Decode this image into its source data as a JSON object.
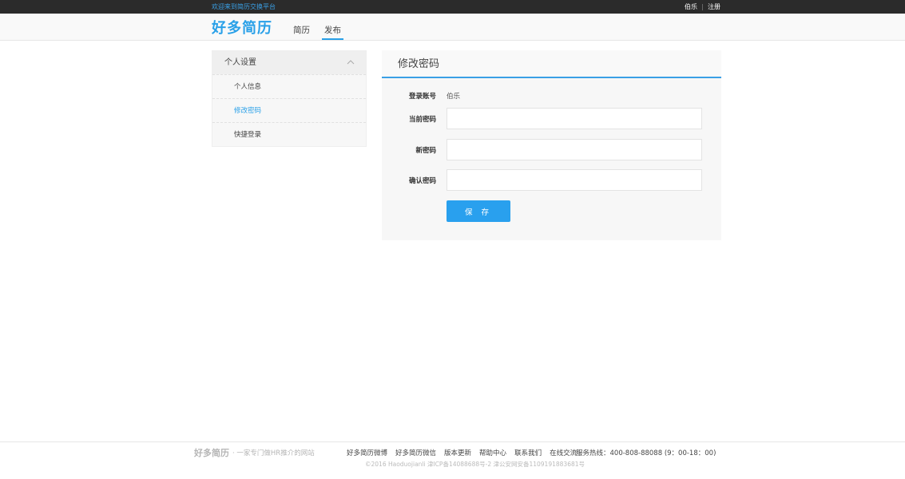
{
  "topbar": {
    "welcome": "欢迎来到简历交换平台",
    "user": "伯乐",
    "register": "注册"
  },
  "header": {
    "logo": "好多简历",
    "nav": [
      {
        "label": "简历",
        "active": false
      },
      {
        "label": "发布",
        "active": true
      }
    ]
  },
  "sidebar": {
    "title": "个人设置",
    "items": [
      {
        "label": "个人信息",
        "active": false
      },
      {
        "label": "修改密码",
        "active": true
      },
      {
        "label": "快捷登录",
        "active": false
      }
    ]
  },
  "panel": {
    "title": "修改密码",
    "account_label": "登录账号",
    "account_value": "伯乐",
    "current_password_label": "当前密码",
    "new_password_label": "新密码",
    "confirm_password_label": "确认密码",
    "current_password_value": "",
    "new_password_value": "",
    "confirm_password_value": "",
    "save_label": "保 存"
  },
  "footer": {
    "logo": "好多简历",
    "slogan": "· 一家专门做HR推介的网站",
    "links": [
      "好多简历微博",
      "好多简历微信",
      "版本更新",
      "帮助中心",
      "联系我们",
      "在线交流"
    ],
    "hotline": "服务热线：400-808-88088 (9：00-18：00)",
    "copyright": "©2016 Haoduojianli 津ICP备14088688号-2 津公安网安备1109191883681号"
  },
  "colors": {
    "accent": "#29a0e8",
    "topbar_bg": "#2b2b2b",
    "panel_bg": "#f7f7f7"
  }
}
